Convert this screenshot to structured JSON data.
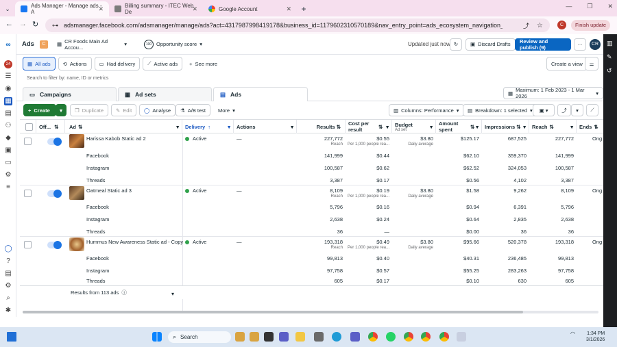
{
  "browser": {
    "tabs": [
      {
        "title": "Ads Manager - Manage ads - A",
        "color": "#1877f2"
      },
      {
        "title": "Billing summary - ITEC Web De",
        "color": "#7b7b7b"
      },
      {
        "title": "Google Account",
        "color": "#4285f4"
      }
    ],
    "url": "adsmanager.facebook.com/adsmanager/manage/ads?act=431798799841917​8&business_id=1179602310570189&nav_entry_point=ads_ecosystem_navigation_menu&date=2026-01-...",
    "update_label": "Finish update",
    "profile_initial": "C"
  },
  "app": {
    "title": "Ads",
    "account_name": "CR Foods Main Ad Accou...",
    "opportunity_label": "Opportunity score",
    "opportunity_value": "100",
    "updated_text": "Updated just now",
    "discard_label": "Discard Drafts",
    "review_label": "Review and publish (9)",
    "notif_count": "24"
  },
  "filters": {
    "all_ads": "All ads",
    "actions": "Actions",
    "had_delivery": "Had delivery",
    "active_ads": "Active ads",
    "see_more": "See more",
    "create_view": "Create a view",
    "search_placeholder": "Search to filter by: name, ID or metrics"
  },
  "levels": {
    "campaigns": "Campaigns",
    "adsets": "Ad sets",
    "ads": "Ads",
    "date_range": "Maximum: 1 Feb 2023 - 1 Mar 2026"
  },
  "toolbar": {
    "create": "Create",
    "duplicate": "Duplicate",
    "edit": "Edit",
    "analyse": "Analyse",
    "abtest": "A/B test",
    "more": "More",
    "columns": "Columns: Performance",
    "breakdown": "Breakdown: 1 selected"
  },
  "columns": {
    "off_on": "Off...",
    "ad": "Ad",
    "delivery": "Delivery",
    "actions": "Actions",
    "results": "Results",
    "cost": "Cost per result",
    "budget": "Budget",
    "budget_sub": "Ad set",
    "amount": "Amount spent",
    "impressions": "Impressions",
    "reach": "Reach",
    "ends": "Ends"
  },
  "rows": [
    {
      "name": "Harissa Kabob Static ad 2",
      "delivery": "Active",
      "actions": "—",
      "results": "227,772",
      "results_sub": "Reach",
      "cost": "$0.55",
      "cost_sub": "Per 1,000 people rea...",
      "budget": "$3.80",
      "budget_sub": "Daily average",
      "amount": "$125.17",
      "impressions": "687,525",
      "reach": "227,772",
      "ends": "Ong",
      "breakdown": [
        {
          "platform": "Facebook",
          "results": "141,999",
          "cost": "$0.44",
          "amount": "$62.10",
          "impressions": "359,370",
          "reach": "141,999"
        },
        {
          "platform": "Instagram",
          "results": "100,587",
          "cost": "$0.62",
          "amount": "$62.52",
          "impressions": "324,053",
          "reach": "100,587"
        },
        {
          "platform": "Threads",
          "results": "3,387",
          "cost": "$0.17",
          "amount": "$0.56",
          "impressions": "4,102",
          "reach": "3,387"
        }
      ]
    },
    {
      "name": "Oatmeal Static ad 3",
      "delivery": "Active",
      "actions": "—",
      "results": "8,109",
      "results_sub": "Reach",
      "cost": "$0.19",
      "cost_sub": "Per 1,000 people rea...",
      "budget": "$3.80",
      "budget_sub": "Daily average",
      "amount": "$1.58",
      "impressions": "9,262",
      "reach": "8,109",
      "ends": "Ong",
      "breakdown": [
        {
          "platform": "Facebook",
          "results": "5,796",
          "cost": "$0.16",
          "amount": "$0.94",
          "impressions": "6,391",
          "reach": "5,796"
        },
        {
          "platform": "Instagram",
          "results": "2,638",
          "cost": "$0.24",
          "amount": "$0.64",
          "impressions": "2,835",
          "reach": "2,638"
        },
        {
          "platform": "Threads",
          "results": "36",
          "cost": "—",
          "amount": "$0.00",
          "impressions": "36",
          "reach": "36"
        }
      ]
    },
    {
      "name": "Hummus New Awareness Static ad - Copy",
      "delivery": "Active",
      "actions": "—",
      "results": "193,318",
      "results_sub": "Reach",
      "cost": "$0.49",
      "cost_sub": "Per 1,000 people rea...",
      "budget": "$3.80",
      "budget_sub": "Daily average",
      "amount": "$95.66",
      "impressions": "520,378",
      "reach": "193,318",
      "ends": "Ong",
      "breakdown": [
        {
          "platform": "Facebook",
          "results": "99,813",
          "cost": "$0.40",
          "amount": "$40.31",
          "impressions": "236,485",
          "reach": "99,813"
        },
        {
          "platform": "Instagram",
          "results": "97,758",
          "cost": "$0.57",
          "amount": "$55.25",
          "impressions": "283,263",
          "reach": "97,758"
        },
        {
          "platform": "Threads",
          "results": "605",
          "cost": "$0.17",
          "amount": "$0.10",
          "impressions": "630",
          "reach": "605"
        }
      ]
    }
  ],
  "footer": {
    "results_text": "Results from 113 ads"
  },
  "taskbar": {
    "search": "Search",
    "time": "1:34 PM",
    "date": "3/1/2026"
  },
  "colors": {
    "accent": "#0a66c2",
    "create": "#1f7a34",
    "active_dot": "#31a24c"
  }
}
